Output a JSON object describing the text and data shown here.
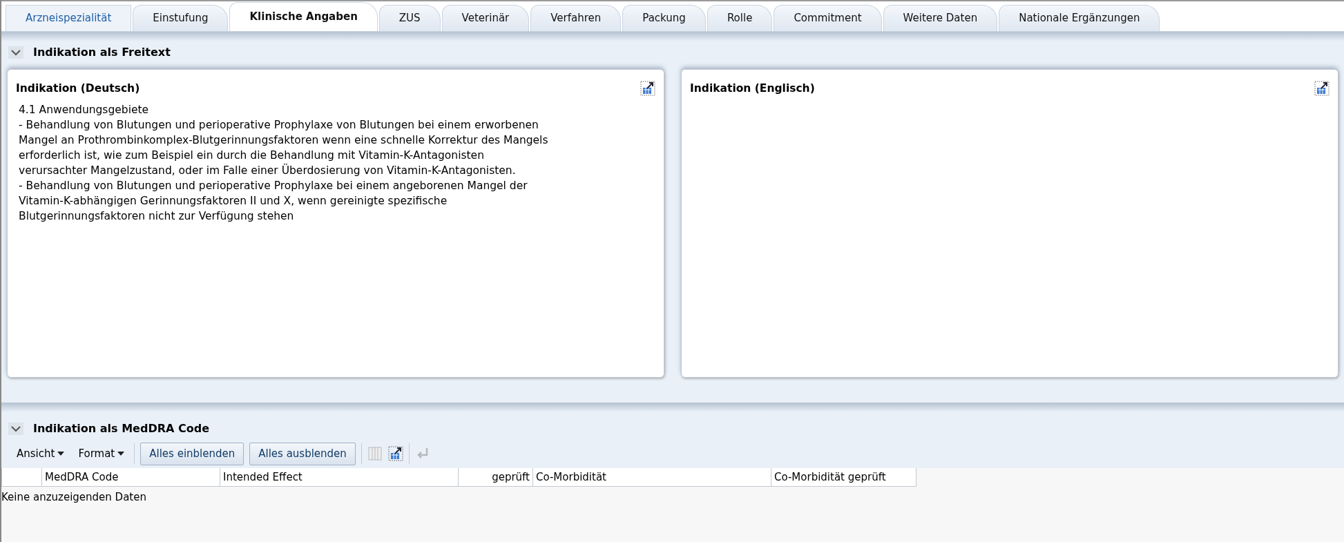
{
  "tabs": [
    {
      "label": "Arzneispezialität",
      "selected": false,
      "kind": "link"
    },
    {
      "label": "Einstufung",
      "selected": false,
      "kind": "tab"
    },
    {
      "label": "Klinische Angaben",
      "selected": true,
      "kind": "tab"
    },
    {
      "label": "ZUS",
      "selected": false,
      "kind": "tab"
    },
    {
      "label": "Veterinär",
      "selected": false,
      "kind": "tab"
    },
    {
      "label": "Verfahren",
      "selected": false,
      "kind": "tab"
    },
    {
      "label": "Packung",
      "selected": false,
      "kind": "tab"
    },
    {
      "label": "Rolle",
      "selected": false,
      "kind": "tab"
    },
    {
      "label": "Commitment",
      "selected": false,
      "kind": "tab"
    },
    {
      "label": "Weitere Daten",
      "selected": false,
      "kind": "tab"
    },
    {
      "label": "Nationale Ergänzungen",
      "selected": false,
      "kind": "tab"
    }
  ],
  "freetext_section": {
    "title": "Indikation als Freitext",
    "expanded": true,
    "panels": [
      {
        "title": "Indikation (Deutsch)",
        "text": "4.1 Anwendungsgebiete\n- Behandlung von Blutungen und perioperative Prophylaxe von Blutungen bei einem erworbenen\nMangel an Prothrombinkomplex-Blutgerinnungsfaktoren wenn eine schnelle Korrektur des Mangels\nerforderlich ist, wie zum Beispiel ein durch die Behandlung mit Vitamin-K-Antagonisten\nverursachter Mangelzustand, oder im Falle einer Überdosierung von Vitamin-K-Antagonisten.\n- Behandlung von Blutungen und perioperative Prophylaxe bei einem angeborenen Mangel der\nVitamin-K-abhängigen Gerinnungsfaktoren II und X, wenn gereinigte spezifische\nBlutgerinnungsfaktoren nicht zur Verfügung stehen"
      },
      {
        "title": "Indikation (Englisch)"
      }
    ]
  },
  "meddra_section": {
    "title": "Indikation als MedDRA Code",
    "expanded": true,
    "menus": [
      "Ansicht",
      "Format"
    ],
    "buttons": [
      "Alles einblenden",
      "Alles ausblenden"
    ],
    "tool_icons": [
      {
        "kind": "columns",
        "disabled": true
      },
      {
        "kind": "detach",
        "disabled": false
      },
      {
        "kind": "wrap",
        "disabled": true
      }
    ],
    "table": {
      "columns": [
        "MedDRA Code",
        "Intended Effect",
        "geprüft",
        "Co-Morbidität",
        "Co-Morbidität geprüft"
      ],
      "empty_text": "Keine anzuzeigenden Daten"
    }
  }
}
